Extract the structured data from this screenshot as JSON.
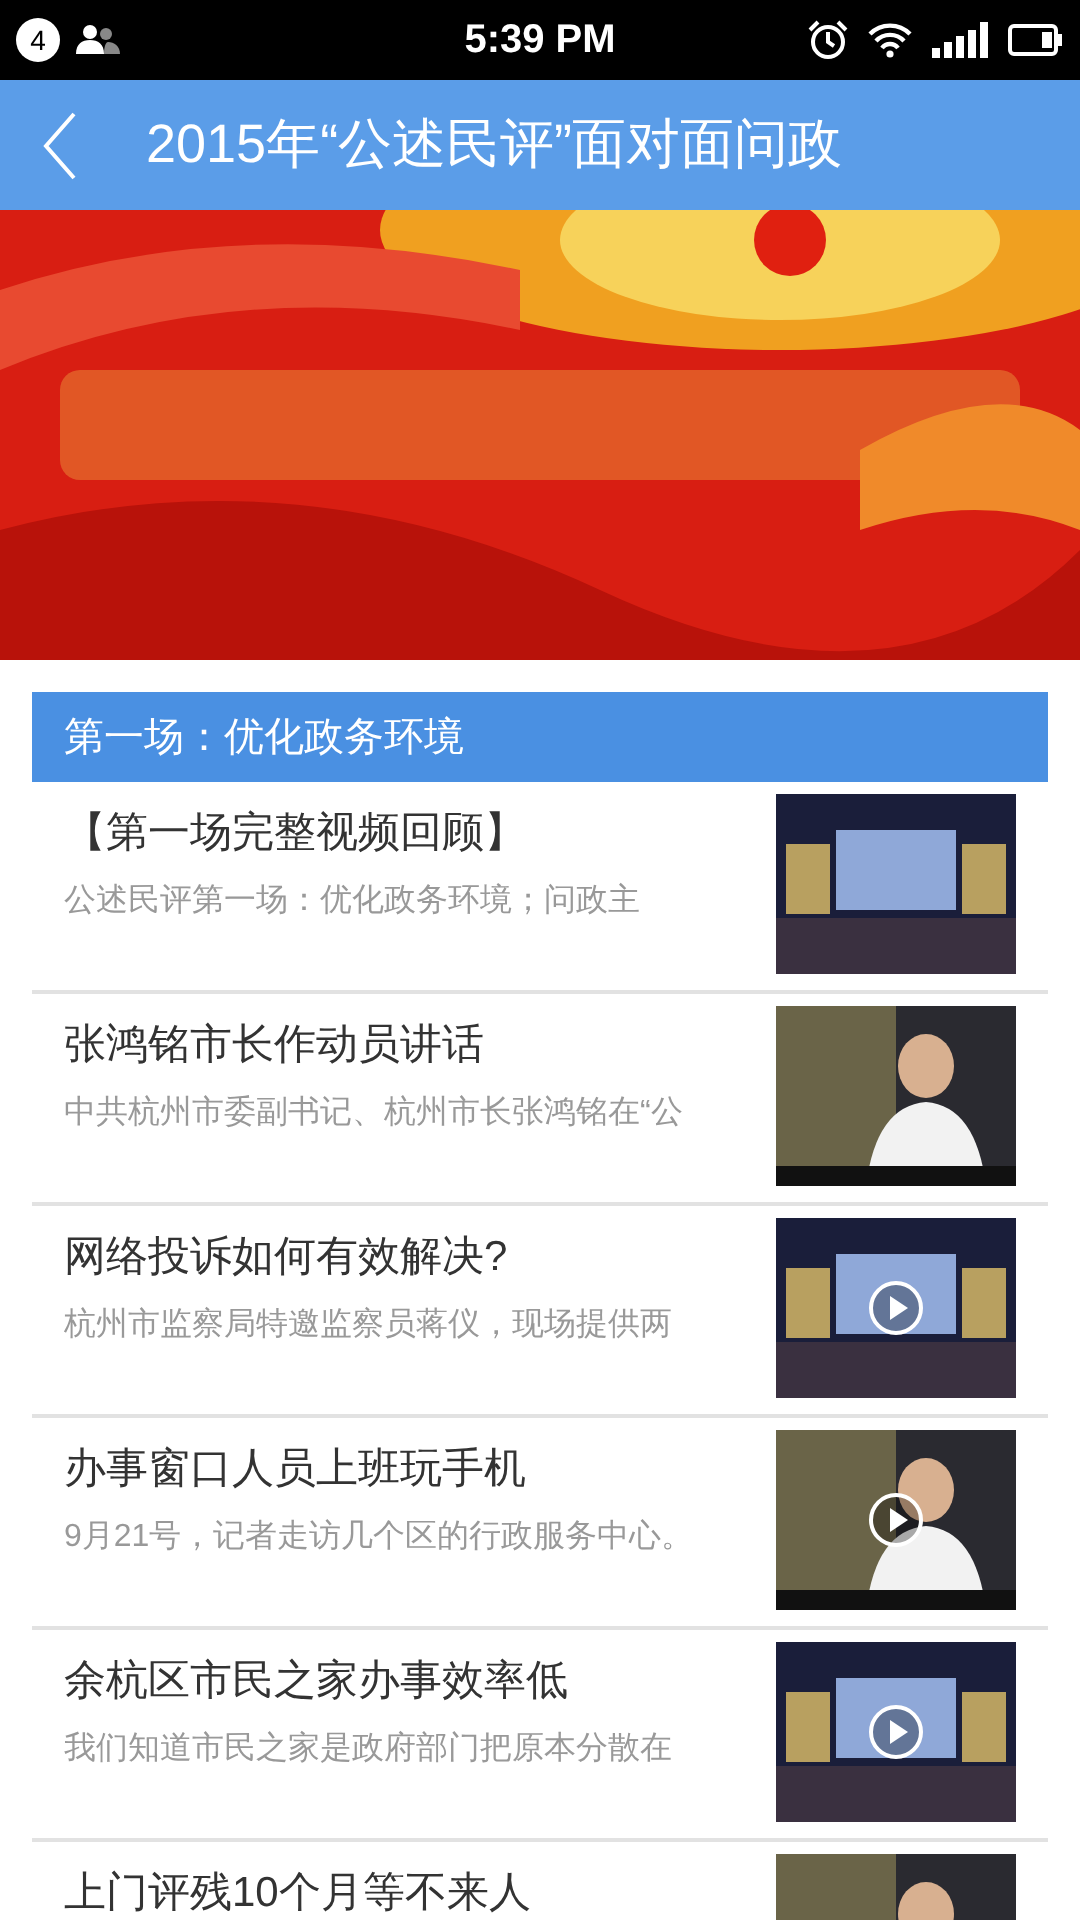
{
  "status_bar": {
    "notification_count": "4",
    "time": "5:39 PM"
  },
  "header": {
    "title": "2015年“公述民评”面对面问政"
  },
  "section": {
    "title": "第一场：优化政务环境"
  },
  "items": [
    {
      "title": "【第一场完整视频回顾】",
      "summary": "公述民评第一场：优化政务环境；问政主",
      "play": false
    },
    {
      "title": "张鸿铭市长作动员讲话",
      "summary": "中共杭州市委副书记、杭州市长张鸿铭在“公",
      "play": false
    },
    {
      "title": "网络投诉如何有效解决?",
      "summary": "杭州市监察局特邀监察员蒋仪，现场提供两",
      "play": true
    },
    {
      "title": "办事窗口人员上班玩手机",
      "summary": "9月21号，记者走访几个区的行政服务中心。",
      "play": true
    },
    {
      "title": "余杭区市民之家办事效率低",
      "summary": "我们知道市民之家是政府部门把原本分散在",
      "play": true
    },
    {
      "title": "上门评残10个月等不来人",
      "play": false
    }
  ]
}
